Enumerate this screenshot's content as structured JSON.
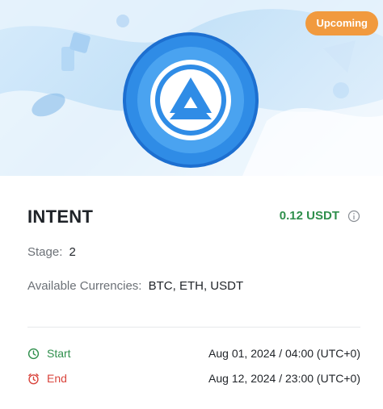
{
  "badge": {
    "label": "Upcoming"
  },
  "token": {
    "name": "INTENT",
    "price": "0.12 USDT",
    "stage_label": "Stage:",
    "stage_value": "2",
    "currencies_label": "Available Currencies:",
    "currencies_value": "BTC, ETH, USDT"
  },
  "schedule": {
    "start_label": "Start",
    "start_value": "Aug 01, 2024 / 04:00 (UTC+0)",
    "end_label": "End",
    "end_value": "Aug 12, 2024 / 23:00 (UTC+0)"
  },
  "colors": {
    "badge": "#f19a3e",
    "price": "#2f8f4c",
    "start": "#2f8f4c",
    "end": "#d9453d",
    "coin_blue": "#2f8ce6"
  }
}
